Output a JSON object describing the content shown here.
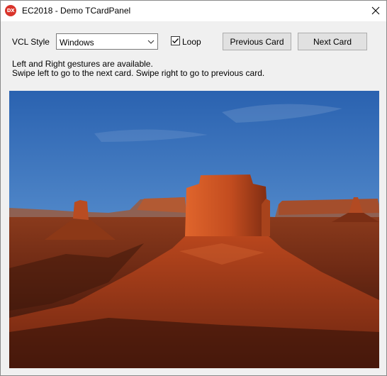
{
  "window": {
    "title": "EC2018 - Demo TCardPanel",
    "app_icon_text": "DX",
    "app_icon": "app-logo-icon"
  },
  "controls": {
    "style_label": "VCL Style",
    "style_value": "Windows",
    "loop_label": "Loop",
    "loop_checked": true,
    "prev_label": "Previous Card",
    "next_label": "Next Card"
  },
  "info": {
    "line1": "Left and Right gestures are available.",
    "line2": "Swipe left to go to the next card. Swipe right to go to previous card."
  },
  "card": {
    "image": "desert-monument-valley-photo"
  },
  "colors": {
    "icon_red": "#d9342b",
    "button_bg": "#e1e1e1",
    "window_bg": "#f0f0f0"
  }
}
